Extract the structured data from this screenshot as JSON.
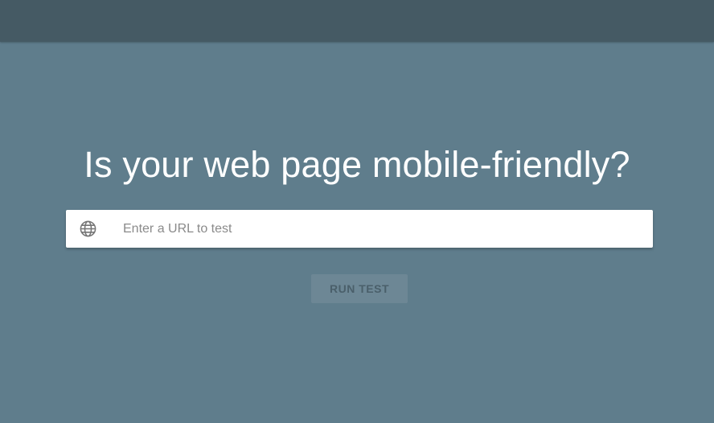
{
  "hero": {
    "headline": "Is your web page mobile-friendly?"
  },
  "search": {
    "icon": "globe-icon",
    "value": "",
    "placeholder": "Enter a URL to test"
  },
  "actions": {
    "run_test_label": "RUN TEST"
  },
  "colors": {
    "background": "#5f7d8c",
    "top_bar": "#455a64",
    "button_disabled_bg": "#6d8795",
    "button_disabled_text": "#4a5f6a"
  }
}
